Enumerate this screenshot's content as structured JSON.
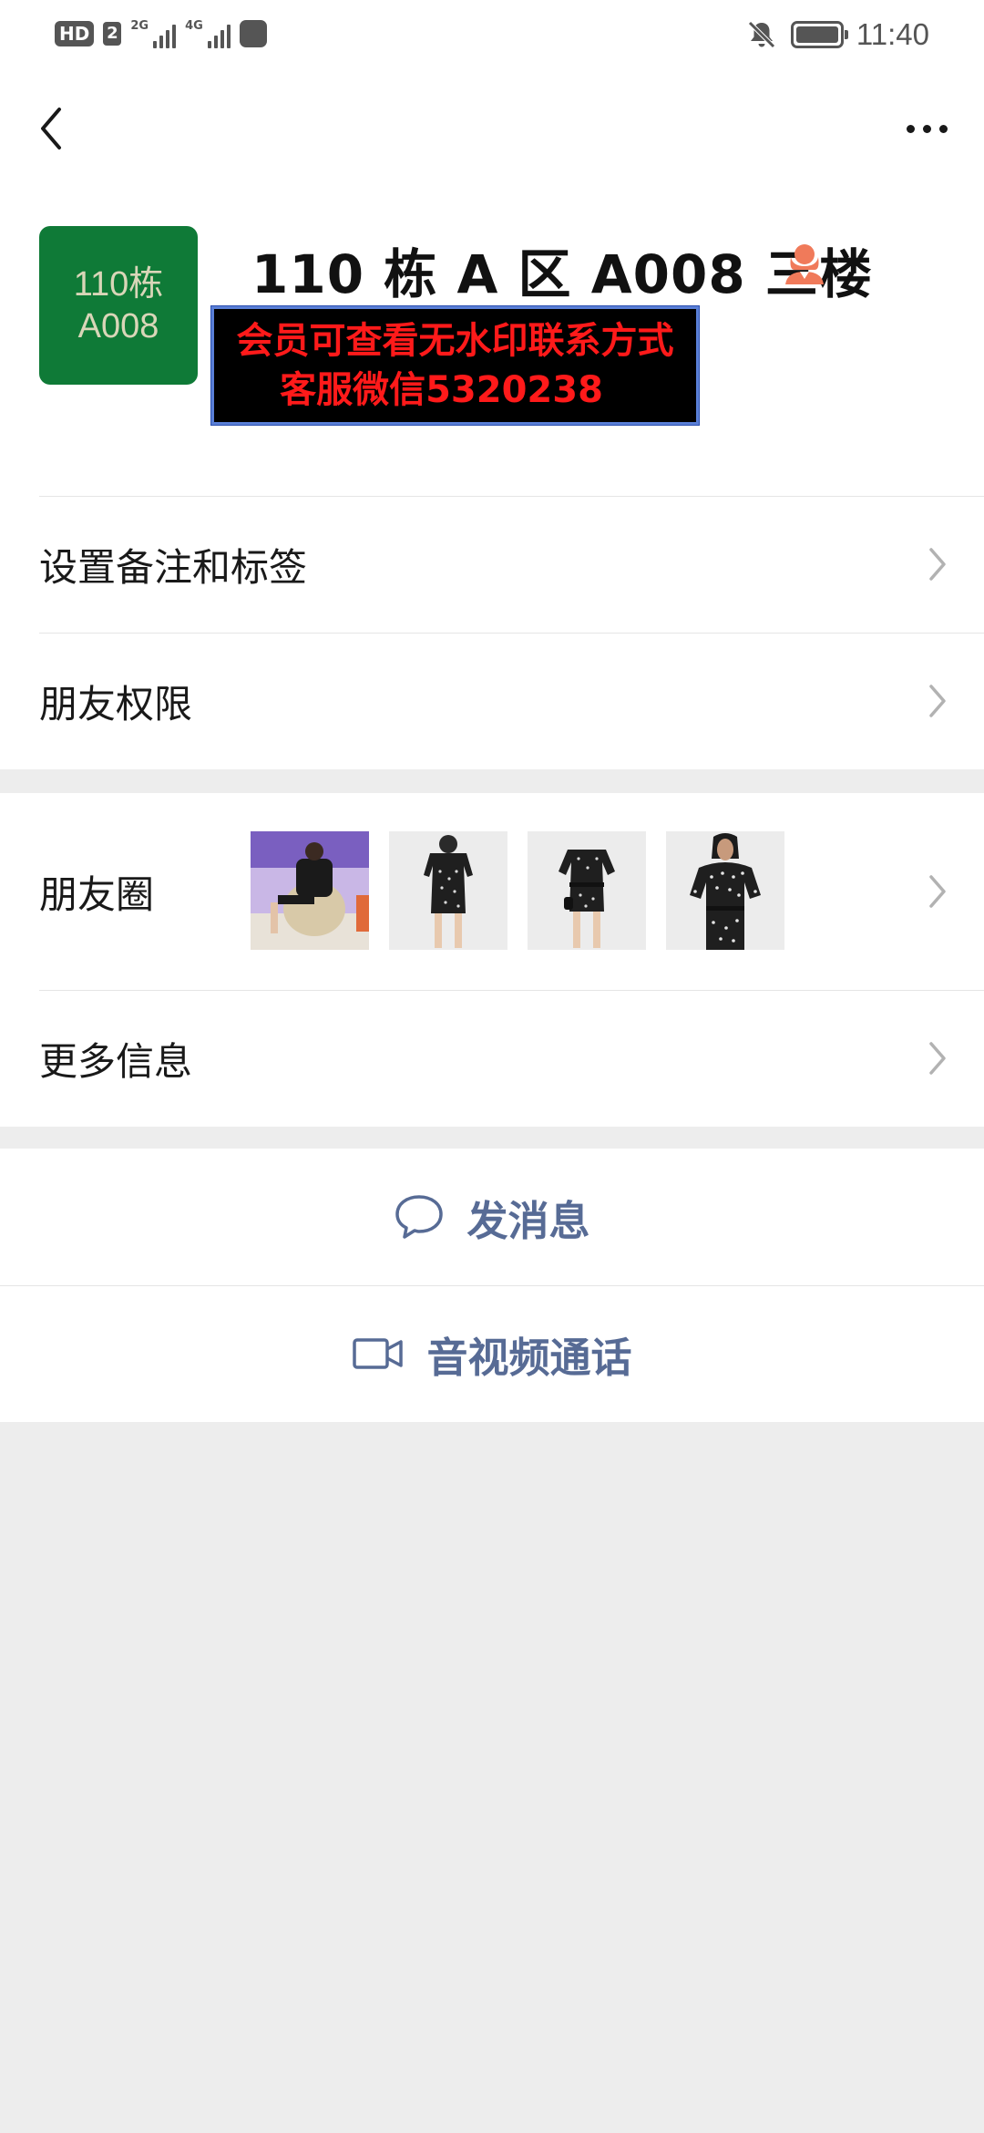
{
  "status_bar": {
    "hd": "HD",
    "sim": "2",
    "net1": "2G",
    "net2": "4G",
    "time": "11:40"
  },
  "profile": {
    "avatar_line1": "110栋",
    "avatar_line2": "A008",
    "name": "110 栋 A 区 A008 三楼",
    "gender_icon": "female-icon",
    "watermark_line1": "会员可查看无水印联系方式",
    "watermark_line2": "客服微信5320238"
  },
  "menu": {
    "remark_label": "设置备注和标签",
    "permissions_label": "朋友权限",
    "moments_label": "朋友圈",
    "more_info_label": "更多信息"
  },
  "actions": {
    "message_label": "发消息",
    "call_label": "音视频通话"
  },
  "colors": {
    "link": "#576b95",
    "avatar_bg": "#0f7a37",
    "watermark_text": "#ff1a1a"
  }
}
